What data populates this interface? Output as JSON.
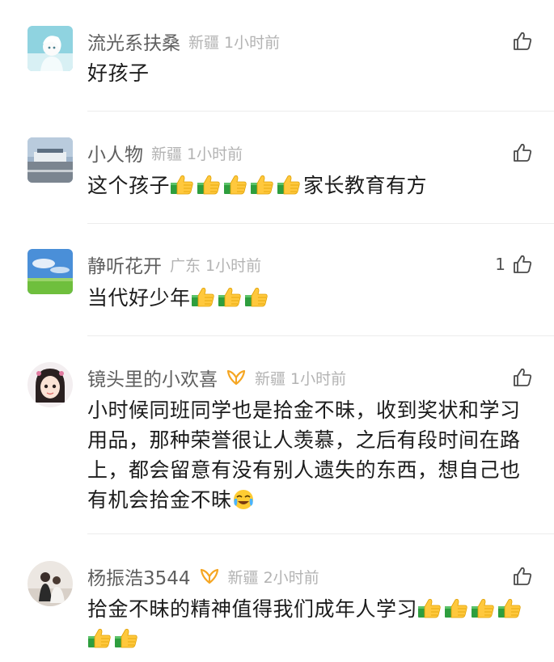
{
  "comments": [
    {
      "username": "流光系扶桑",
      "location": "新疆",
      "time": "1小时前",
      "likes": "",
      "text": "好孩子",
      "thumbs": 0,
      "has_vip": false
    },
    {
      "username": "小人物",
      "location": "新疆",
      "time": "1小时前",
      "likes": "",
      "text_before": "这个孩子",
      "thumbs": 5,
      "text_after": "家长教育有方",
      "has_vip": false
    },
    {
      "username": "静听花开",
      "location": "广东",
      "time": "1小时前",
      "likes": "1",
      "text_before": "当代好少年",
      "thumbs": 3,
      "has_vip": false
    },
    {
      "username": "镜头里的小欢喜",
      "location": "新疆",
      "time": "1小时前",
      "likes": "",
      "text": "小时候同班同学也是拾金不昧，收到奖状和学习用品，那种荣誉很让人羡慕，之后有段时间在路上，都会留意有没有别人遗失的东西，想自己也有机会拾金不昧",
      "trailing_emoji": "cry-laugh-emoji",
      "has_vip": true
    },
    {
      "username": "杨振浩3544",
      "location": "新疆",
      "time": "2小时前",
      "likes": "",
      "text": "拾金不昧的精神值得我们成年人学习",
      "thumbs": 6,
      "has_vip": true
    }
  ],
  "icons": {
    "like": "thumbs-up-outline-icon",
    "vip": "vip-badge-icon",
    "thumb_emoji": "thumbs-up-emoji"
  },
  "colors": {
    "username": "#5f5f5f",
    "meta": "#b3b3b3",
    "text": "#1c1c1c",
    "vip": "#f5a623",
    "divider": "#ececec"
  }
}
